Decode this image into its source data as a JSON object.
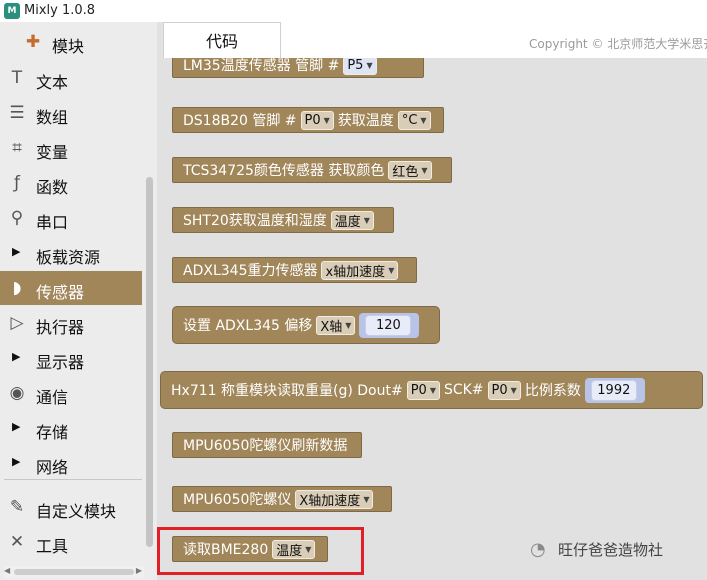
{
  "window": {
    "title": "Mixly 1.0.8",
    "logo": "M"
  },
  "sidebar": {
    "categories": [
      {
        "label": "模块",
        "icon": "puzzle-icon",
        "glyph": "✚"
      },
      {
        "label": "文本",
        "icon": "text-icon",
        "glyph": "T"
      },
      {
        "label": "数组",
        "icon": "list-icon",
        "glyph": "☰"
      },
      {
        "label": "变量",
        "icon": "variable-icon",
        "glyph": "⌗"
      },
      {
        "label": "函数",
        "icon": "function-icon",
        "glyph": "ƒ"
      },
      {
        "label": "串口",
        "icon": "serial-icon",
        "glyph": "⚲"
      },
      {
        "label": "板载资源",
        "icon": "caret-right-icon",
        "glyph": "▶"
      },
      {
        "label": "传感器",
        "icon": "sensor-icon",
        "glyph": "◗"
      },
      {
        "label": "执行器",
        "icon": "actuator-icon",
        "glyph": "▷"
      },
      {
        "label": "显示器",
        "icon": "caret-right-icon",
        "glyph": "▶"
      },
      {
        "label": "通信",
        "icon": "signal-icon",
        "glyph": "◉"
      },
      {
        "label": "存储",
        "icon": "caret-right-icon",
        "glyph": "▶"
      },
      {
        "label": "网络",
        "icon": "caret-right-icon",
        "glyph": "▶"
      },
      {
        "label": "自定义模块",
        "icon": "pen-icon",
        "glyph": "✎"
      },
      {
        "label": "工具",
        "icon": "tools-icon",
        "glyph": "✕"
      }
    ],
    "selected": "传感器"
  },
  "tabs": {
    "code": "代码"
  },
  "copyright": "Copyright © 北京师范大学米思齐",
  "blocks": {
    "lm35": {
      "text": "LM35温度传感器 管脚 #",
      "pin": "P5"
    },
    "ds18b20": {
      "text1": "DS18B20 管脚 #",
      "pin": "P0",
      "text2": "获取温度",
      "unit": "°C"
    },
    "tcs34725": {
      "text": "TCS34725颜色传感器 获取颜色",
      "color": "红色"
    },
    "sht20": {
      "text": "SHT20获取温度和湿度",
      "option": "温度"
    },
    "adxl345": {
      "text": "ADXL345重力传感器",
      "option": "x轴加速度"
    },
    "adxl345_offset": {
      "text1": "设置 ADXL345 偏移",
      "axis": "X轴",
      "value": "120"
    },
    "hx711": {
      "text1": "Hx711 称重模块读取重量(g) Dout#",
      "dout": "P0",
      "text2": "SCK#",
      "sck": "P0",
      "text3": "比例系数",
      "value": "1992"
    },
    "mpu6050_refresh": {
      "text": "MPU6050陀螺仪刷新数据"
    },
    "mpu6050": {
      "text": "MPU6050陀螺仪",
      "option": "X轴加速度"
    },
    "bme280": {
      "text": "读取BME280",
      "option": "温度"
    }
  },
  "watermark": {
    "text": "旺仔爸爸造物社"
  },
  "colors": {
    "block": "#a1865a",
    "highlight": "#e11f26",
    "selected": "#a1865a"
  }
}
